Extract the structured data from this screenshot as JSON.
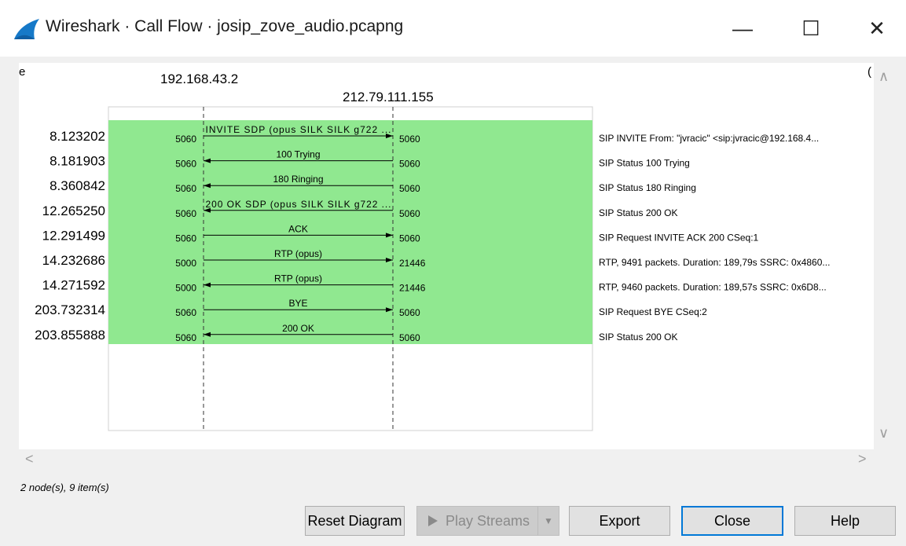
{
  "window": {
    "title": "Wireshark · Call Flow · josip_zove_audio.pcapng",
    "minimize_glyph": "—",
    "maximize_glyph": "☐",
    "close_glyph": "✕"
  },
  "diagram": {
    "left_edge_fragment": "e",
    "right_edge_fragment": "(",
    "node1": "192.168.43.2",
    "node2": "212.79.111.155",
    "flows": [
      {
        "time": "8.123202",
        "src_port": "5060",
        "label": "INVITE SDP (opus SILK SILK g722 ...",
        "dst_port": "5060",
        "direction": "right",
        "comment": "SIP INVITE From: \"jvracic\" <sip:jvracic@192.168.4..."
      },
      {
        "time": "8.181903",
        "src_port": "5060",
        "label": "100 Trying",
        "dst_port": "5060",
        "direction": "left",
        "comment": "SIP Status 100 Trying"
      },
      {
        "time": "8.360842",
        "src_port": "5060",
        "label": "180 Ringing",
        "dst_port": "5060",
        "direction": "left",
        "comment": "SIP Status 180 Ringing"
      },
      {
        "time": "12.265250",
        "src_port": "5060",
        "label": "200 OK SDP (opus SILK SILK g722 ...",
        "dst_port": "5060",
        "direction": "left",
        "comment": "SIP Status 200 OK"
      },
      {
        "time": "12.291499",
        "src_port": "5060",
        "label": "ACK",
        "dst_port": "5060",
        "direction": "right",
        "comment": "SIP Request INVITE ACK 200 CSeq:1"
      },
      {
        "time": "14.232686",
        "src_port": "5000",
        "label": "RTP (opus)",
        "dst_port": "21446",
        "direction": "right",
        "comment": "RTP, 9491 packets. Duration: 189,79s SSRC: 0x4860..."
      },
      {
        "time": "14.271592",
        "src_port": "5000",
        "label": "RTP (opus)",
        "dst_port": "21446",
        "direction": "left",
        "comment": "RTP, 9460 packets. Duration: 189,57s SSRC: 0x6D8..."
      },
      {
        "time": "203.732314",
        "src_port": "5060",
        "label": "BYE",
        "dst_port": "5060",
        "direction": "right",
        "comment": "SIP Request BYE CSeq:2"
      },
      {
        "time": "203.855888",
        "src_port": "5060",
        "label": "200 OK",
        "dst_port": "5060",
        "direction": "left",
        "comment": "SIP Status 200 OK"
      }
    ],
    "highlight_color": "#90e890"
  },
  "scroll": {
    "up": "∧",
    "down": "∨",
    "left": "<",
    "right": ">"
  },
  "status_text": "2 node(s), 9 item(s)",
  "buttons": {
    "reset": "Reset Diagram",
    "play": "Play Streams",
    "play_arrow": "▼",
    "export": "Export",
    "close": "Close",
    "help": "Help"
  }
}
